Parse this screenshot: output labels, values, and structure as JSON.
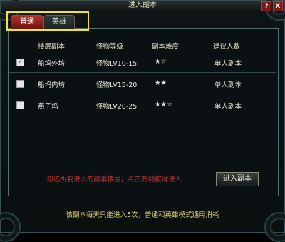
{
  "window": {
    "title": "进入副本",
    "help_label": "?",
    "close_label": "X"
  },
  "tabs": [
    {
      "label": "普通",
      "active": true
    },
    {
      "label": "英雄",
      "active": false
    }
  ],
  "table": {
    "headers": [
      "楼层副本",
      "怪物等级",
      "副本难度",
      "建议人数"
    ],
    "rows": [
      {
        "checked": true,
        "name": "船坞外坊",
        "level": "怪物LV10-15",
        "difficulty": "★☆",
        "players": "单人副本"
      },
      {
        "checked": false,
        "name": "船坞内坊",
        "level": "怪物LV15-20",
        "difficulty": "★★",
        "players": "单人副本"
      },
      {
        "checked": false,
        "name": "燕子坞",
        "level": "怪物LV20-25",
        "difficulty": "★★☆",
        "players": "单人副本"
      }
    ]
  },
  "hint_text": "勾选所要进入的副本楼层，点击右侧按键进入",
  "enter_button": "进入副本",
  "footer_text": "该副本每天只能进入5次，普通和英雄模式通用消耗",
  "colors": {
    "active_tab": "#b3322d",
    "hint": "#c2352f",
    "footer": "#e6d26a",
    "highlight": "#f0e630"
  }
}
